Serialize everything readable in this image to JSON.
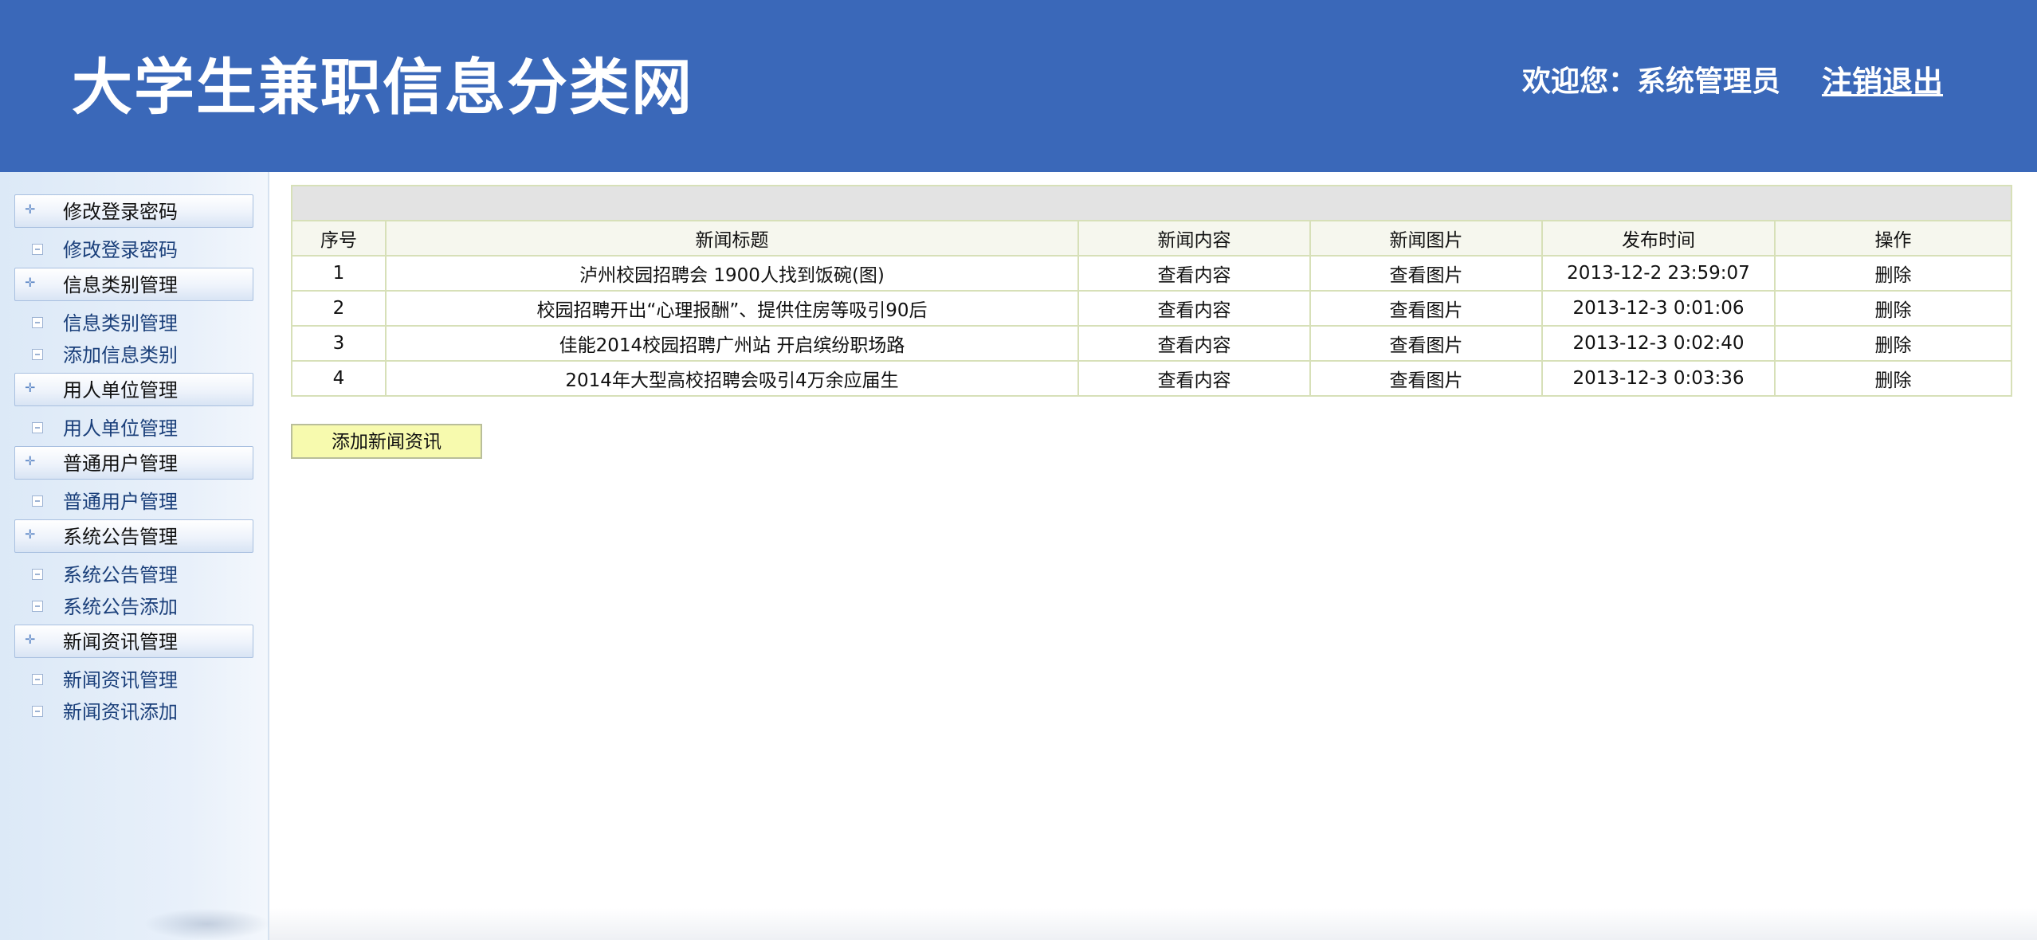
{
  "header": {
    "site_title": "大学生兼职信息分类网",
    "welcome_text": "欢迎您：系统管理员",
    "logout_label": "注销退出"
  },
  "sidebar": {
    "groups": [
      {
        "title": "修改登录密码",
        "items": [
          "修改登录密码"
        ]
      },
      {
        "title": "信息类别管理",
        "items": [
          "信息类别管理",
          "添加信息类别"
        ]
      },
      {
        "title": "用人单位管理",
        "items": [
          "用人单位管理"
        ]
      },
      {
        "title": "普通用户管理",
        "items": [
          "普通用户管理"
        ]
      },
      {
        "title": "系统公告管理",
        "items": [
          "系统公告管理",
          "系统公告添加"
        ]
      },
      {
        "title": "新闻资讯管理",
        "items": [
          "新闻资讯管理",
          "新闻资讯添加"
        ]
      }
    ]
  },
  "news_table": {
    "columns": [
      "序号",
      "新闻标题",
      "新闻内容",
      "新闻图片",
      "发布时间",
      "操作"
    ],
    "rows": [
      {
        "no": "1",
        "title": "泸州校园招聘会 1900人找到饭碗(图)",
        "content_link": "查看内容",
        "image_link": "查看图片",
        "time": "2013-12-2 23:59:07",
        "action": "删除"
      },
      {
        "no": "2",
        "title": "校园招聘开出“心理报酬”、提供住房等吸引90后",
        "content_link": "查看内容",
        "image_link": "查看图片",
        "time": "2013-12-3 0:01:06",
        "action": "删除"
      },
      {
        "no": "3",
        "title": "佳能2014校园招聘广州站 开启缤纷职场路",
        "content_link": "查看内容",
        "image_link": "查看图片",
        "time": "2013-12-3 0:02:40",
        "action": "删除"
      },
      {
        "no": "4",
        "title": "2014年大型高校招聘会吸引4万余应届生",
        "content_link": "查看内容",
        "image_link": "查看图片",
        "time": "2013-12-3 0:03:36",
        "action": "删除"
      }
    ]
  },
  "actions": {
    "add_news_label": "添加新闻资讯"
  }
}
